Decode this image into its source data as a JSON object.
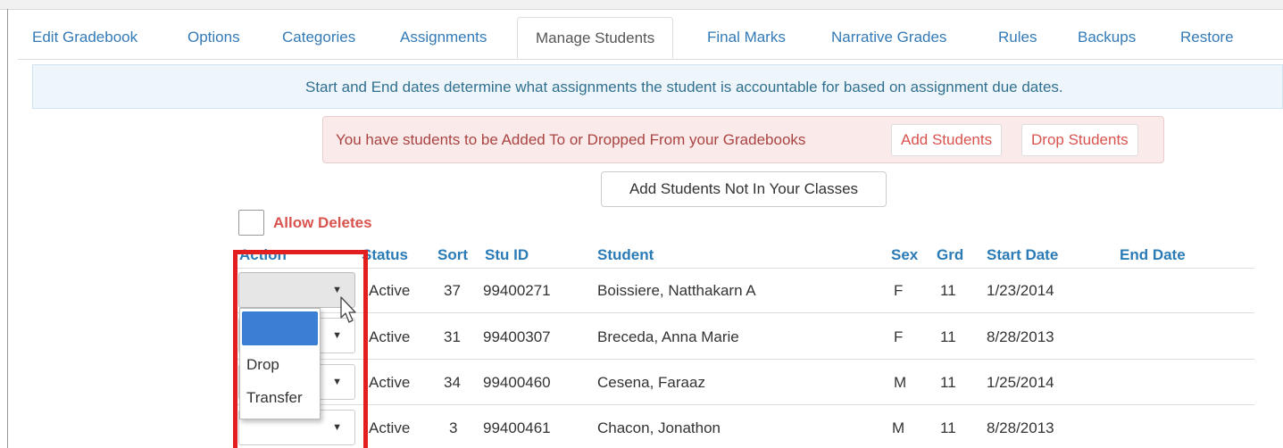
{
  "tabs": [
    {
      "label": "Edit Gradebook",
      "active": false
    },
    {
      "label": "Options",
      "active": false
    },
    {
      "label": "Categories",
      "active": false
    },
    {
      "label": "Assignments",
      "active": false
    },
    {
      "label": "Manage Students",
      "active": true
    },
    {
      "label": "Final Marks",
      "active": false
    },
    {
      "label": "Narrative Grades",
      "active": false
    },
    {
      "label": "Rules",
      "active": false
    },
    {
      "label": "Backups",
      "active": false
    },
    {
      "label": "Restore",
      "active": false
    }
  ],
  "info_message": "Start and End dates determine what assignments the student is accountable for based on assignment due dates.",
  "warning": {
    "text": "You have students to be Added To or Dropped From your Gradebooks",
    "add_label": "Add Students",
    "drop_label": "Drop Students"
  },
  "add_not_in_classes_label": "Add Students Not In Your Classes",
  "allow_deletes": {
    "label": "Allow Deletes",
    "checked": false
  },
  "table": {
    "headers": {
      "action": "Action",
      "status": "Status",
      "sort": "Sort",
      "stu_id": "Stu ID",
      "student": "Student",
      "sex": "Sex",
      "grd": "Grd",
      "start_date": "Start Date",
      "end_date": "End Date"
    },
    "rows": [
      {
        "status": "Active",
        "sort": "37",
        "stu_id": "99400271",
        "student": "Boissiere, Natthakarn A",
        "sex": "F",
        "grd": "11",
        "start_date": "1/23/2014",
        "end_date": ""
      },
      {
        "status": "Active",
        "sort": "31",
        "stu_id": "99400307",
        "student": "Breceda, Anna Marie",
        "sex": "F",
        "grd": "11",
        "start_date": "8/28/2013",
        "end_date": ""
      },
      {
        "status": "Active",
        "sort": "34",
        "stu_id": "99400460",
        "student": "Cesena, Faraaz",
        "sex": "M",
        "grd": "11",
        "start_date": "1/25/2014",
        "end_date": ""
      },
      {
        "status": "Active",
        "sort": "3",
        "stu_id": "99400461",
        "student": "Chacon, Jonathon",
        "sex": "M",
        "grd": "11",
        "start_date": "8/28/2013",
        "end_date": ""
      }
    ]
  },
  "action_dropdown": {
    "options": [
      "",
      "Drop",
      "Transfer"
    ],
    "highlighted_index": 0
  },
  "colors": {
    "link": "#337ab7",
    "header_text": "#2a7bb6",
    "danger": "#d9534f",
    "callout_border": "#e31e1e",
    "dropdown_highlight": "#3b7fd4"
  }
}
